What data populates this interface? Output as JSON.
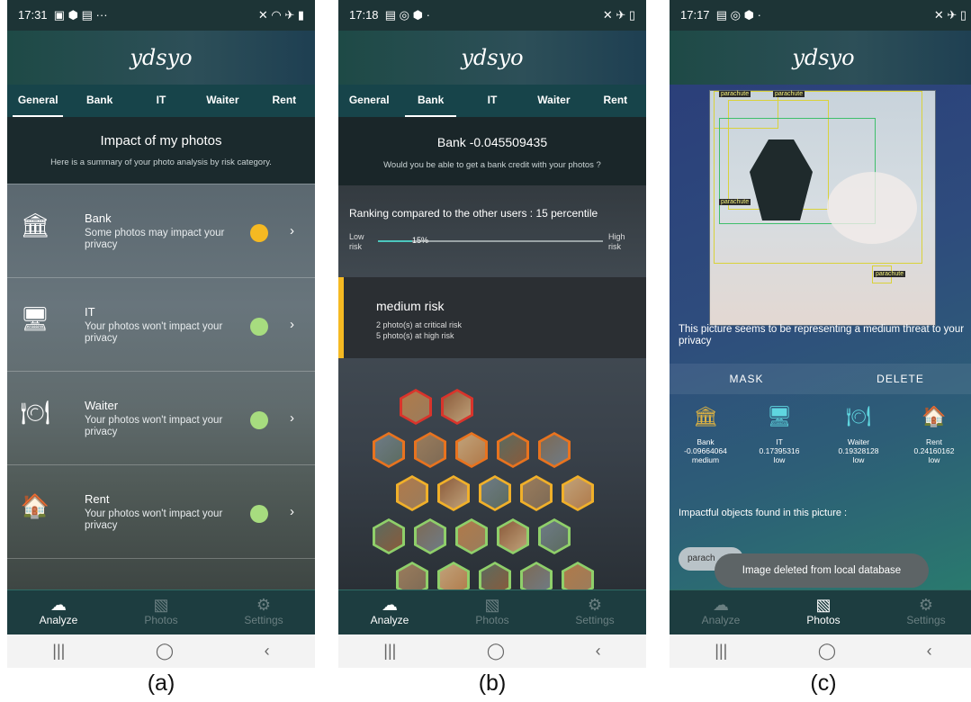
{
  "phones": [
    {
      "status_time": "17:31",
      "status_icons_left": "▣ ⬢ ▤  ···",
      "status_icons_right": "✕ ◠ ✈ ▮",
      "logo": "ydsyo",
      "tabs": [
        "General",
        "Bank",
        "IT",
        "Waiter",
        "Rent"
      ],
      "active_tab": "General",
      "hero_title": "Impact of my photos",
      "hero_sub": "Here is a summary of your photo analysis by risk category.",
      "categories": [
        {
          "label": "Bank",
          "desc": "Some photos may impact your privacy",
          "color": "#f5b922",
          "icon": "bank-icon"
        },
        {
          "label": "IT",
          "desc": "Your photos won't impact your privacy",
          "color": "#a7dc7f",
          "icon": "it-desk-icon"
        },
        {
          "label": "Waiter",
          "desc": "Your photos won't impact your privacy",
          "color": "#a7dc7f",
          "icon": "waiter-icon"
        },
        {
          "label": "Rent",
          "desc": "Your photos won't impact your privacy",
          "color": "#a7dc7f",
          "icon": "house-icon"
        }
      ],
      "nav": [
        "Analyze",
        "Photos",
        "Settings"
      ],
      "active_nav": "Analyze"
    },
    {
      "status_time": "17:18",
      "status_icons_left": "▤ ◎ ⬢  ·",
      "status_icons_right": "✕ ✈ ▯",
      "logo": "ydsyo",
      "tabs": [
        "General",
        "Bank",
        "IT",
        "Waiter",
        "Rent"
      ],
      "active_tab": "Bank",
      "bank_title": "Bank -0.045509435",
      "bank_sub": "Would you be able to get a bank credit with your photos ?",
      "ranking": "Ranking compared to the other users : 15 percentile",
      "low_risk": "Low risk",
      "high_risk": "High risk",
      "percentile": 15,
      "percentile_label": "15%",
      "risk_level": "medium risk",
      "risk_lines": [
        "2 photo(s) at critical risk",
        "5 photo(s) at high risk"
      ],
      "nav": [
        "Analyze",
        "Photos",
        "Settings"
      ],
      "active_nav": "Analyze"
    },
    {
      "status_time": "17:17",
      "status_icons_left": "▤ ◎ ⬢  ·",
      "status_icons_right": "✕ ✈ ▯",
      "logo": "ydsyo",
      "detection_label": "parachute",
      "threat_text": "This picture seems to be representing a medium threat to your privacy",
      "mask_label": "MASK",
      "delete_label": "DELETE",
      "scores": [
        {
          "name": "Bank",
          "value": "-0.09664064",
          "level": "medium",
          "icon": "bank-icon"
        },
        {
          "name": "IT",
          "value": "0.17395316",
          "level": "low",
          "icon": "it-desk-icon"
        },
        {
          "name": "Waiter",
          "value": "0.19328128",
          "level": "low",
          "icon": "waiter-icon"
        },
        {
          "name": "Rent",
          "value": "0.24160162",
          "level": "low",
          "icon": "house-icon"
        }
      ],
      "impact_title": "Impactful objects found in this picture :",
      "chip_label": "parach",
      "toast": "Image deleted from local database",
      "nav": [
        "Analyze",
        "Photos",
        "Settings"
      ],
      "active_nav": "Photos"
    }
  ],
  "captions": [
    "(a)",
    "(b)",
    "(c)"
  ],
  "sysnav": [
    "|||",
    "◯",
    "‹"
  ],
  "hex_colors": [
    "#d9342b",
    "#d9342b",
    "#e8731f",
    "#e8731f",
    "#e8731f",
    "#e8731f",
    "#e8731f",
    "#f0b02a",
    "#f0b02a",
    "#f0b02a",
    "#f0b02a",
    "#f0b02a",
    "#8fcf6a",
    "#8fcf6a",
    "#8fcf6a",
    "#8fcf6a",
    "#8fcf6a",
    "#8fcf6a",
    "#8fcf6a",
    "#8fcf6a",
    "#8fcf6a",
    "#8fcf6a"
  ]
}
